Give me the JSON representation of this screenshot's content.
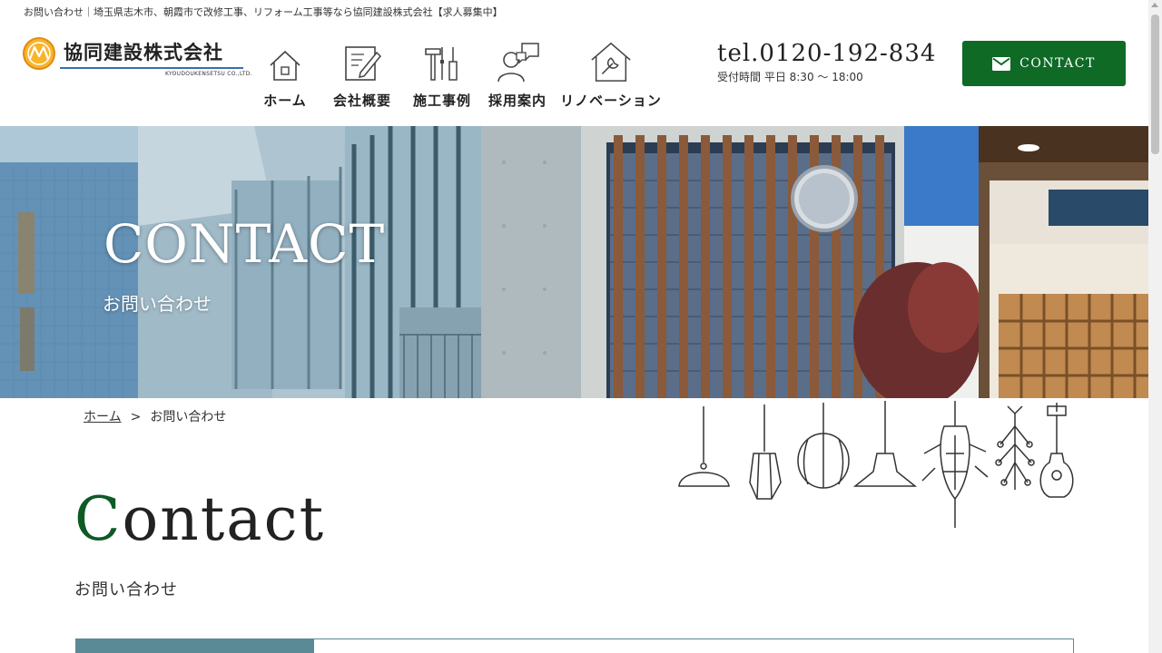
{
  "header": {
    "caption": "お問い合わせ｜埼玉県志木市、朝霞市で改修工事、リフォーム工事等なら協同建設株式会社【求人募集中】",
    "logo": {
      "name": "協同建設株式会社",
      "sub": "KYOUDOUKENSETSU CO.,LTD."
    },
    "nav": [
      {
        "label": "ホーム",
        "icon": "house-icon"
      },
      {
        "label": "会社概要",
        "icon": "notepad-pencil-icon"
      },
      {
        "label": "施工事例",
        "icon": "tools-icon"
      },
      {
        "label": "採用案内",
        "icon": "person-chat-icon"
      },
      {
        "label": "リノベーション",
        "icon": "house-wrench-icon"
      }
    ],
    "tel": {
      "number": "tel.0120-192-834",
      "hours": "受付時間 平日 8:30 〜 18:00"
    },
    "contact_button": {
      "label": "CONTACT",
      "icon": "envelope-icon"
    }
  },
  "hero": {
    "title": "CONTACT",
    "subtitle": "お問い合わせ"
  },
  "breadcrumb": {
    "home": "ホーム",
    "separator": ">",
    "current": "お問い合わせ"
  },
  "section": {
    "heading_initial": "C",
    "heading_rest": "ontact",
    "subheading": "お問い合わせ"
  },
  "colors": {
    "brand_green": "#0e6a25",
    "accent_teal": "#5a8a96",
    "logo_orange": "#f0a020"
  }
}
